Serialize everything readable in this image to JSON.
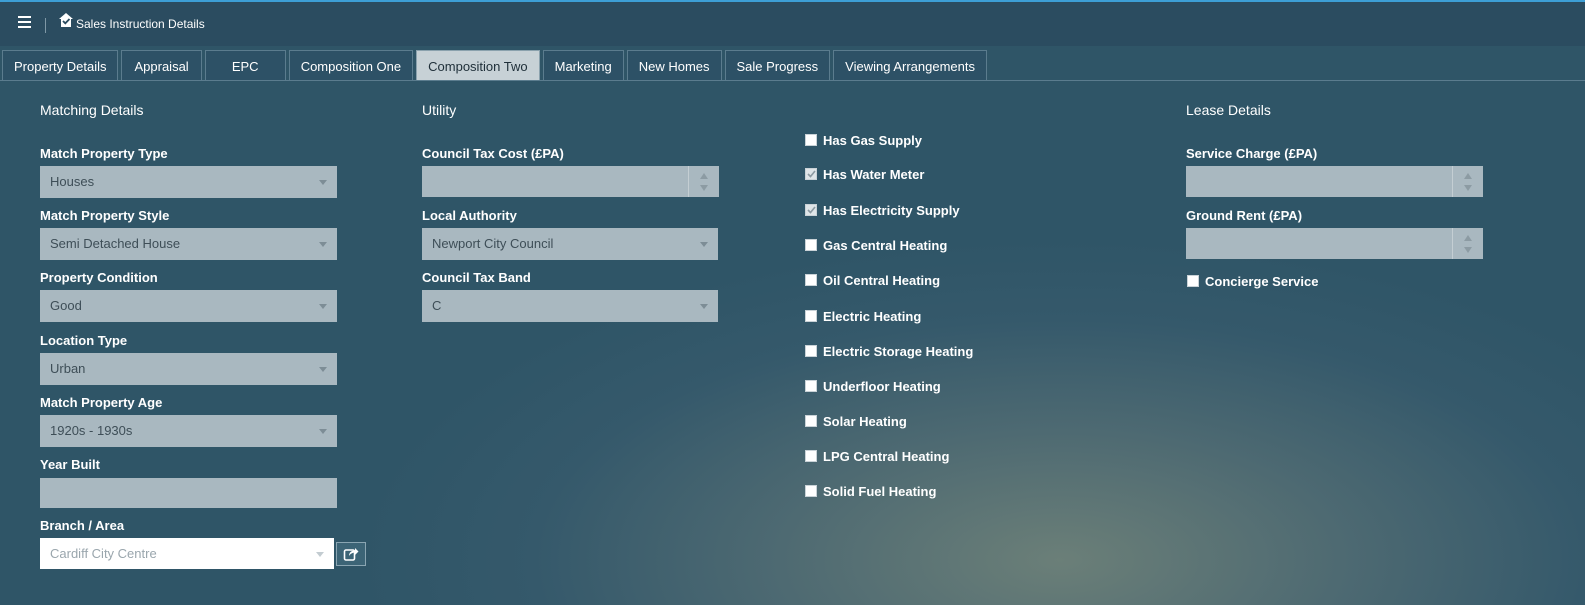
{
  "header": {
    "title": "Sales Instruction Details"
  },
  "tabs": [
    {
      "label": "Property Details",
      "active": false
    },
    {
      "label": "Appraisal",
      "active": false
    },
    {
      "label": "EPC",
      "active": false
    },
    {
      "label": "Composition One",
      "active": false
    },
    {
      "label": "Composition Two",
      "active": true
    },
    {
      "label": "Marketing",
      "active": false
    },
    {
      "label": "New Homes",
      "active": false
    },
    {
      "label": "Sale Progress",
      "active": false
    },
    {
      "label": "Viewing Arrangements",
      "active": false
    }
  ],
  "matching": {
    "title": "Matching Details",
    "property_type": {
      "label": "Match Property Type",
      "value": "Houses"
    },
    "property_style": {
      "label": "Match Property Style",
      "value": "Semi Detached House"
    },
    "condition": {
      "label": "Property Condition",
      "value": "Good"
    },
    "location_type": {
      "label": "Location Type",
      "value": "Urban"
    },
    "property_age": {
      "label": "Match Property Age",
      "value": "1920s - 1930s"
    },
    "year_built": {
      "label": "Year Built",
      "value": ""
    },
    "branch": {
      "label": "Branch / Area",
      "value": "Cardiff City Centre"
    }
  },
  "utility": {
    "title": "Utility",
    "council_tax_cost": {
      "label": "Council Tax Cost (£PA)",
      "value": ""
    },
    "local_authority": {
      "label": "Local Authority",
      "value": "Newport City Council"
    },
    "council_tax_band": {
      "label": "Council Tax Band",
      "value": "C"
    }
  },
  "features": [
    {
      "label": "Has Gas Supply",
      "checked": false
    },
    {
      "label": "Has Water Meter",
      "checked": true
    },
    {
      "label": "Has Electricity Supply",
      "checked": true
    },
    {
      "label": "Gas Central Heating",
      "checked": false
    },
    {
      "label": "Oil Central Heating",
      "checked": false
    },
    {
      "label": "Electric Heating",
      "checked": false
    },
    {
      "label": "Electric Storage Heating",
      "checked": false
    },
    {
      "label": "Underfloor Heating",
      "checked": false
    },
    {
      "label": "Solar Heating",
      "checked": false
    },
    {
      "label": "LPG Central Heating",
      "checked": false
    },
    {
      "label": "Solid Fuel Heating",
      "checked": false
    }
  ],
  "lease": {
    "title": "Lease Details",
    "service_charge": {
      "label": "Service Charge (£PA)",
      "value": ""
    },
    "ground_rent": {
      "label": "Ground Rent (£PA)",
      "value": ""
    },
    "concierge": {
      "label": "Concierge Service",
      "checked": false
    }
  }
}
